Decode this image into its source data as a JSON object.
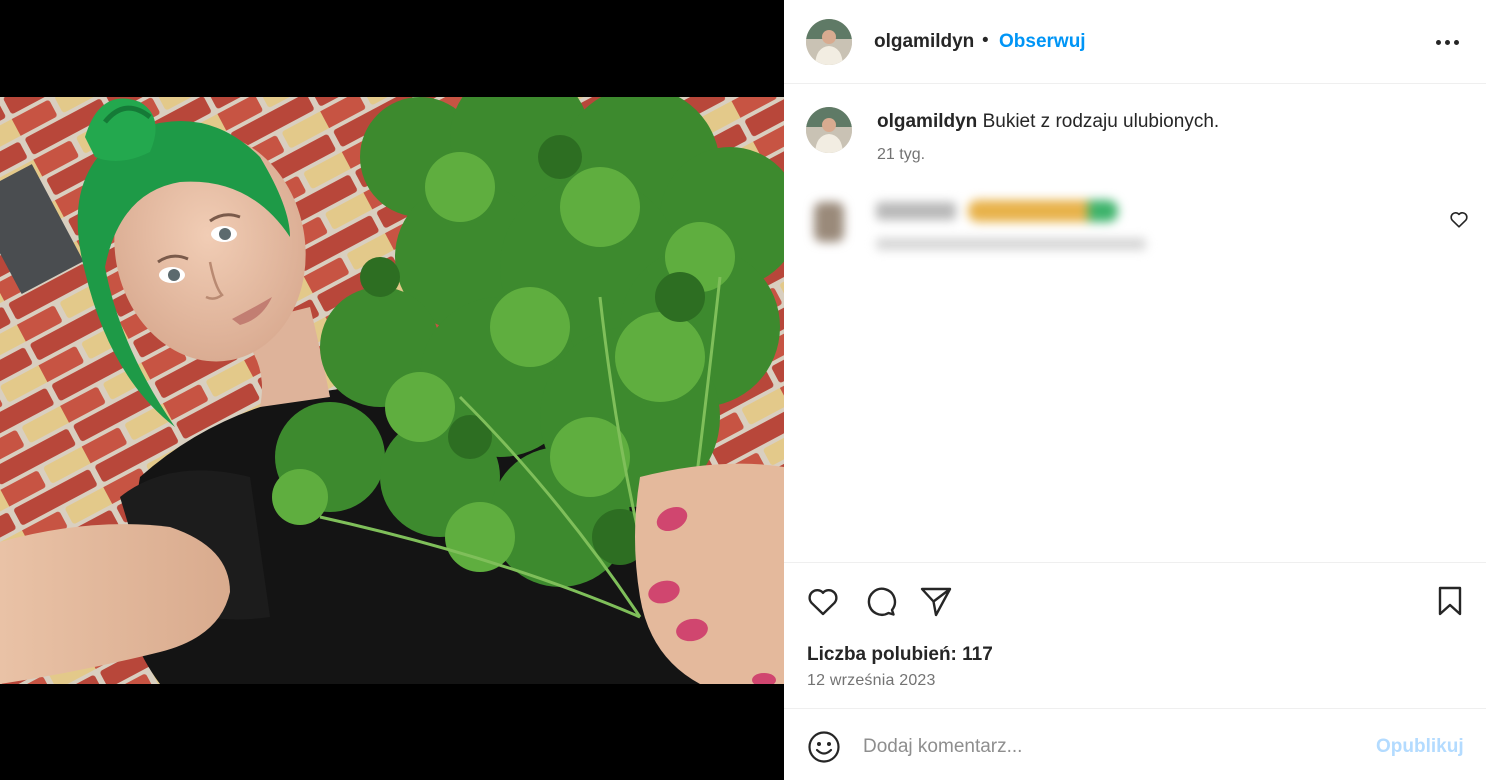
{
  "post": {
    "username": "olgamildyn",
    "separator": "•",
    "follow_label": "Obserwuj",
    "more_icon": "more-horizontal-icon"
  },
  "caption": {
    "username": "olgamildyn",
    "text": "Bukiet z rodzaju ulubionych.",
    "time": "21 tyg."
  },
  "actions": {
    "likes_text": "Liczba polubień: 117",
    "date": "12 września 2023"
  },
  "comment_box": {
    "placeholder": "Dodaj komentarz...",
    "publish_label": "Opublikuj"
  },
  "colors": {
    "accent": "#0095f6",
    "publish_disabled": "#b3dbff",
    "text": "#262626",
    "muted": "#737373"
  }
}
